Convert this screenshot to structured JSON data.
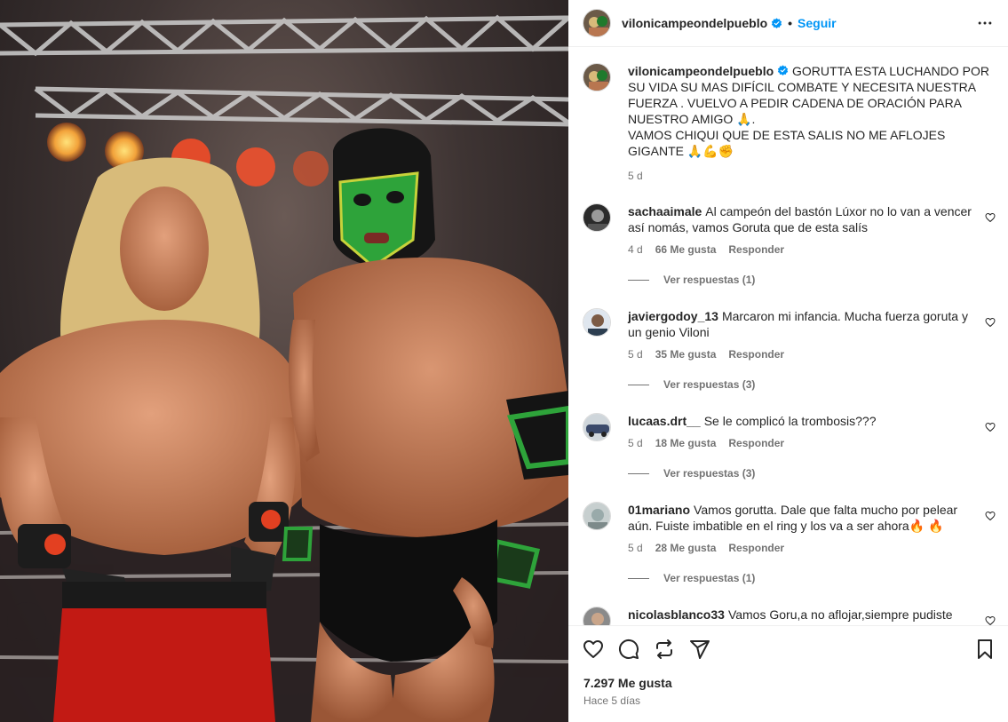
{
  "post": {
    "author": "vilonicampeondelpueblo",
    "follow_label": "Seguir",
    "separator": "•",
    "more_icon": "more-horizontal-icon",
    "image_alt": "Dos luchadores posando en un ring"
  },
  "caption": {
    "username": "vilonicampeondelpueblo",
    "line1": "GORUTTA ESTA LUCHANDO POR SU VIDA SU MAS DIFÍCIL COMBATE Y NECESITA NUESTRA FUERZA . VUELVO A PEDIR CADENA DE ORACIÓN PARA NUESTRO AMIGO 🙏.",
    "line2": "VAMOS CHIQUI QUE DE ESTA SALIS NO ME AFLOJES GIGANTE 🙏💪✊",
    "time": "5 d"
  },
  "comments": [
    {
      "username": "sachaaimale",
      "text": "Al campeón del bastón Lúxor no lo van a vencer así nomás, vamos Goruta que de esta salís",
      "time": "4 d",
      "likes": "66 Me gusta",
      "reply": "Responder",
      "view_replies": "Ver respuestas (1)"
    },
    {
      "username": "javiergodoy_13",
      "text": "Marcaron mi infancia. Mucha fuerza goruta y un genio Viloni",
      "time": "5 d",
      "likes": "35 Me gusta",
      "reply": "Responder",
      "view_replies": "Ver respuestas (3)"
    },
    {
      "username": "lucaas.drt__",
      "text": "Se le complicó la trombosis???",
      "time": "5 d",
      "likes": "18 Me gusta",
      "reply": "Responder",
      "view_replies": "Ver respuestas (3)"
    },
    {
      "username": "01mariano",
      "text": "Vamos gorutta. Dale que falta mucho por pelear aún. Fuiste imbatible en el ring y los va a ser ahora🔥 🔥",
      "time": "5 d",
      "likes": "28 Me gusta",
      "reply": "Responder",
      "view_replies": "Ver respuestas (1)"
    },
    {
      "username": "nicolasblanco33",
      "text": "Vamos Goru,a no aflojar,siempre pudiste",
      "time": "",
      "likes": "",
      "reply": "",
      "view_replies": ""
    }
  ],
  "actions": {
    "like_icon": "heart-icon",
    "comment_icon": "comment-icon",
    "share_icon": "repost-icon",
    "send_icon": "send-icon",
    "save_icon": "bookmark-icon",
    "likes_count": "7.297 Me gusta",
    "posted_ago": "Hace 5 días"
  },
  "colors": {
    "accent": "#0095f6",
    "text": "#262626",
    "muted": "#737373",
    "verified": "#0095f6"
  }
}
